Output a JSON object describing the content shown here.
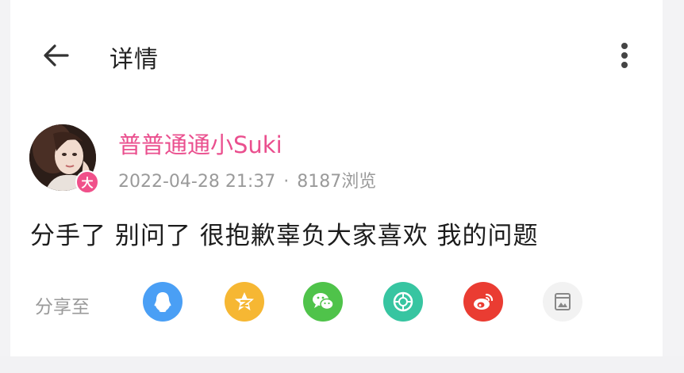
{
  "header": {
    "title": "详情",
    "back_icon": "arrow-left-icon",
    "more_icon": "more-vertical-icon"
  },
  "post": {
    "author": "普普通通小Suki",
    "avatar_badge": "大",
    "time": "2022-04-28 21:37",
    "separator": "·",
    "views": "8187浏览",
    "text": "分手了 别问了 很抱歉辜负大家喜欢 我的问题"
  },
  "share": {
    "label": "分享至",
    "targets": [
      {
        "icon": "qq-icon",
        "color": "#4a9ff5"
      },
      {
        "icon": "qzone-icon",
        "color": "#f6b733"
      },
      {
        "icon": "wechat-icon",
        "color": "#4fc34a"
      },
      {
        "icon": "moments-icon",
        "color": "#37c5a1"
      },
      {
        "icon": "weibo-icon",
        "color": "#ea3c32"
      },
      {
        "icon": "save-image-icon",
        "color": "#f2f2f2"
      }
    ]
  },
  "colors": {
    "accent": "#ea4f8e",
    "muted": "#9a9a9a",
    "text": "#1c1c1c"
  }
}
